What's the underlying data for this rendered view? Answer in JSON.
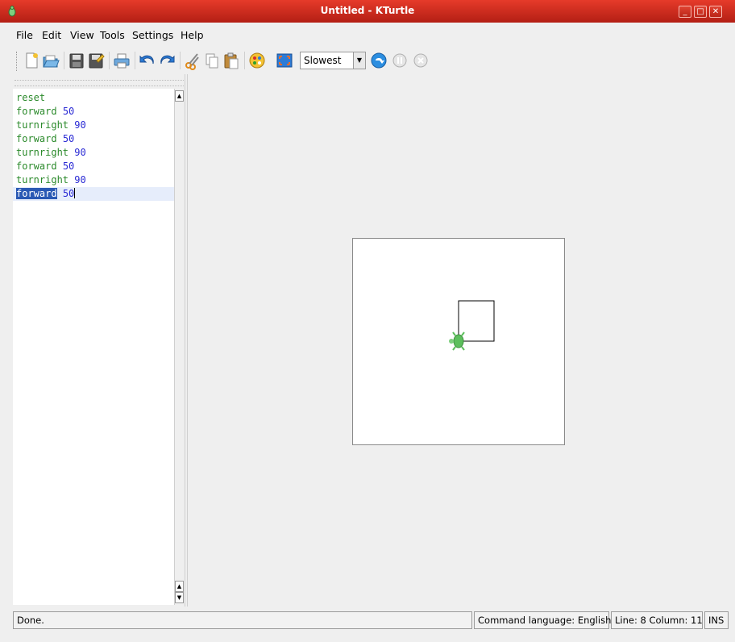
{
  "window": {
    "title": "Untitled - KTurtle",
    "buttons": [
      "_",
      "□",
      "✕"
    ]
  },
  "menu": [
    "File",
    "Edit",
    "View",
    "Tools",
    "Settings",
    "Help"
  ],
  "toolbar": {
    "icons": [
      "new-file-icon",
      "open-file-icon",
      "save-icon",
      "save-as-icon",
      "print-icon",
      "undo-icon",
      "redo-icon",
      "cut-icon",
      "copy-icon",
      "paste-icon",
      "colorpicker-icon",
      "fullscreen-icon"
    ],
    "speed": "Slowest",
    "run_icons": [
      "run-icon",
      "pause-icon",
      "abort-icon"
    ]
  },
  "editor": {
    "lines": [
      {
        "kw": "reset",
        "num": ""
      },
      {
        "kw": "forward",
        "num": "50"
      },
      {
        "kw": "turnright",
        "num": "90"
      },
      {
        "kw": "forward",
        "num": "50"
      },
      {
        "kw": "turnright",
        "num": "90"
      },
      {
        "kw": "forward",
        "num": "50"
      },
      {
        "kw": "turnright",
        "num": "90"
      },
      {
        "kw": "forward",
        "num": "50"
      }
    ]
  },
  "colors": {
    "titlebar": "#cc2e1f",
    "keyword": "#2b8a2b",
    "number": "#2a2ad4",
    "selection": "#2a59b4",
    "turtle": "#5cbf5c"
  },
  "status": {
    "message": "Done.",
    "language": "Command language: English",
    "position": "Line: 8 Column: 11",
    "mode": "INS"
  }
}
